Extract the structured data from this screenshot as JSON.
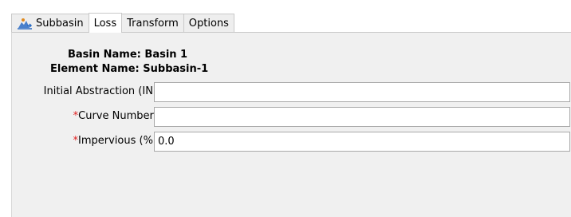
{
  "tabs": [
    {
      "label": "Subbasin",
      "icon": "subbasin-icon"
    },
    {
      "label": "Loss"
    },
    {
      "label": "Transform"
    },
    {
      "label": "Options"
    }
  ],
  "active_tab": "Loss",
  "info": {
    "basin_label": "Basin Name:",
    "basin_value": "Basin 1",
    "element_label": "Element Name:",
    "element_value": "Subbasin-1"
  },
  "fields": [
    {
      "label": "Initial Abstraction (IN)",
      "required": false,
      "value": ""
    },
    {
      "label": "Curve Number:",
      "required": true,
      "value": ""
    },
    {
      "label": "Impervious (%)",
      "required": true,
      "value": "0.0"
    }
  ],
  "required_marker": "*",
  "colors": {
    "required": "#e02020",
    "panel_bg": "#f0f0f0",
    "tab_bg": "#eeeeee",
    "field_border": "#a9a9a9",
    "icon_blue": "#2b6cc4",
    "icon_orange": "#e08a1e"
  }
}
